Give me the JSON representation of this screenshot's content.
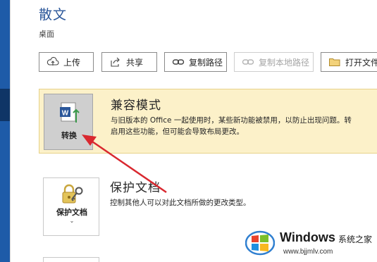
{
  "document": {
    "title": "散文",
    "location": "桌面"
  },
  "toolbar": {
    "upload_label": "上传",
    "share_label": "共享",
    "copy_path_label": "复制路径",
    "copy_local_path_label": "复制本地路径",
    "open_file_location_label": "打开文件"
  },
  "compatibility": {
    "heading": "兼容模式",
    "tile_label": "转换",
    "description_line1": "与旧版本的 Office 一起使用时，某些新功能被禁用，以防止出现问题。转",
    "description_line2": "启用这些功能，但可能会导致布局更改。"
  },
  "protect": {
    "heading": "保护文档",
    "tile_label": "保护文档",
    "chevron": "⌄",
    "description": "控制其他人可以对此文档所做的更改类型。"
  },
  "watermark": {
    "brand": "Windows",
    "subtitle": "系统之家",
    "url": "www.bjjmlv.com"
  },
  "colors": {
    "accent": "#2b579a",
    "nav": "#1e5ba8",
    "compat_bg": "#fcf1c9",
    "annotation_arrow": "#d9282f"
  }
}
